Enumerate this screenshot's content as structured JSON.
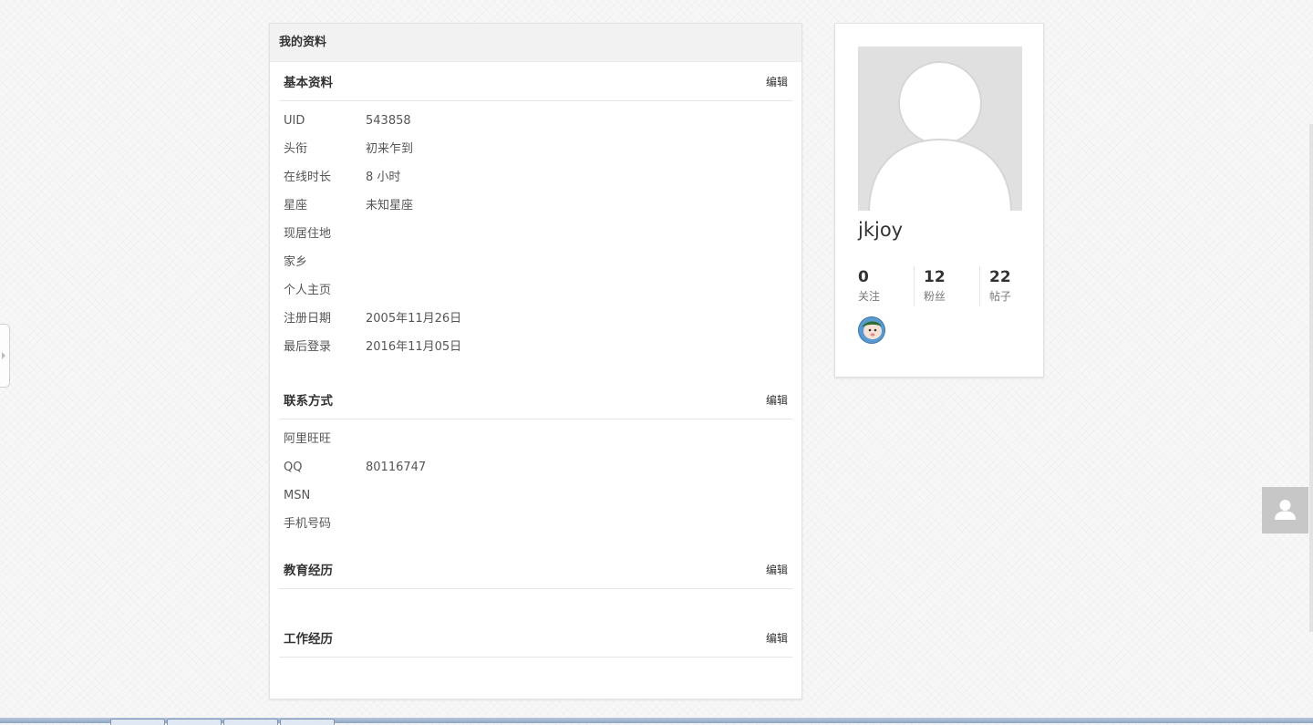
{
  "main": {
    "header_title": "我的资料",
    "sections": [
      {
        "title": "基本资料",
        "edit_label": "编辑",
        "rows": [
          {
            "label": "UID",
            "value": "543858"
          },
          {
            "label": "头衔",
            "value": "初来乍到"
          },
          {
            "label": "在线时长",
            "value": "8 小时"
          },
          {
            "label": "星座",
            "value": "未知星座"
          },
          {
            "label": "现居住地",
            "value": ""
          },
          {
            "label": "家乡",
            "value": ""
          },
          {
            "label": "个人主页",
            "value": ""
          },
          {
            "label": "注册日期",
            "value": "2005年11月26日"
          },
          {
            "label": "最后登录",
            "value": "2016年11月05日"
          }
        ]
      },
      {
        "title": "联系方式",
        "edit_label": "编辑",
        "rows": [
          {
            "label": "阿里旺旺",
            "value": ""
          },
          {
            "label": "QQ",
            "value": "80116747"
          },
          {
            "label": "MSN",
            "value": ""
          },
          {
            "label": "手机号码",
            "value": ""
          }
        ]
      },
      {
        "title": "教育经历",
        "edit_label": "编辑",
        "rows": []
      },
      {
        "title": "工作经历",
        "edit_label": "编辑",
        "rows": []
      }
    ]
  },
  "profile": {
    "username": "jkjoy",
    "stats": [
      {
        "value": "0",
        "label": "关注"
      },
      {
        "value": "12",
        "label": "粉丝"
      },
      {
        "value": "22",
        "label": "帖子"
      }
    ],
    "medal_icon": "cartoon-face-badge-icon",
    "avatar_icon": "default-user-silhouette-icon"
  },
  "icons": {
    "float_button": "user-icon",
    "collapse": "chevron-right-icon"
  },
  "colors": {
    "header_bg": "#f2f2f2",
    "avatar_bg": "#e0e0e0",
    "float_button_bg": "#c7c7c7"
  }
}
